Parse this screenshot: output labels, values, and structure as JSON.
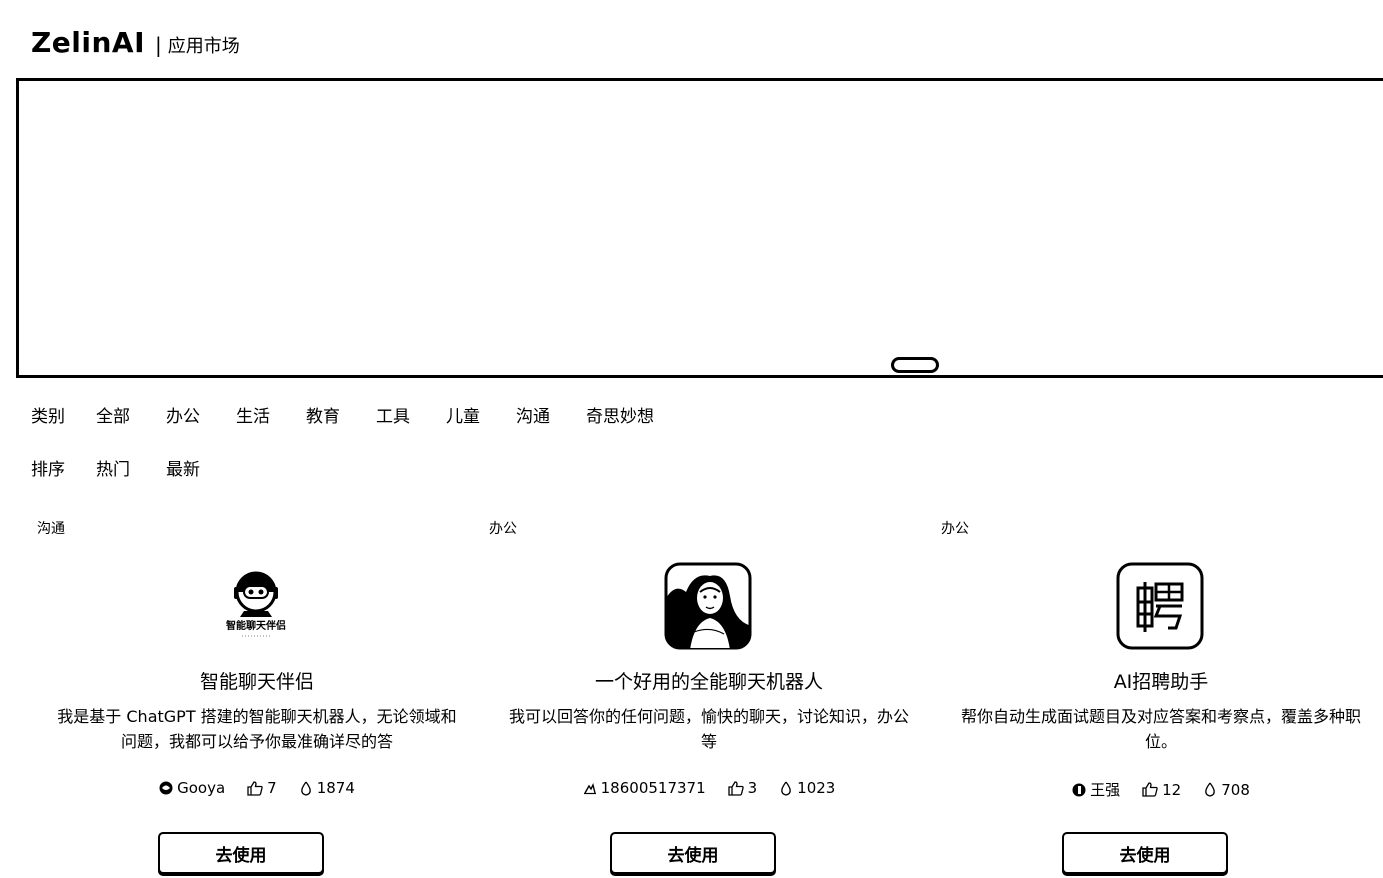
{
  "header": {
    "brand": "ZelinAI",
    "separator": "|",
    "subtitle": "应用市场"
  },
  "filters": {
    "category_label": "类别",
    "categories": [
      "全部",
      "办公",
      "生活",
      "教育",
      "工具",
      "儿童",
      "沟通",
      "奇思妙想"
    ],
    "sort_label": "排序",
    "sorts": [
      "热门",
      "最新"
    ]
  },
  "cards": [
    {
      "tag": "沟通",
      "icon": "robot-logo-icon",
      "icon_text": "智能聊天伴侣",
      "title": "智能聊天伴侣",
      "description": "我是基于 ChatGPT 搭建的智能聊天机器人，无论领域和问题，我都可以给予你最准确详尽的答",
      "author": "Gooya",
      "likes": "7",
      "views": "1874",
      "button": "去使用"
    },
    {
      "tag": "办公",
      "icon": "portrait-avatar-icon",
      "title": "一个好用的全能聊天机器人",
      "description": "我可以回答你的任何问题，愉快的聊天，讨论知识，办公等",
      "author": "18600517371",
      "likes": "3",
      "views": "1023",
      "button": "去使用"
    },
    {
      "tag": "办公",
      "icon": "recruit-logo-icon",
      "title": "AI招聘助手",
      "description": "帮你自动生成面试题目及对应答案和考察点，覆盖多种职位。",
      "author": "王强",
      "likes": "12",
      "views": "708",
      "button": "去使用"
    }
  ]
}
